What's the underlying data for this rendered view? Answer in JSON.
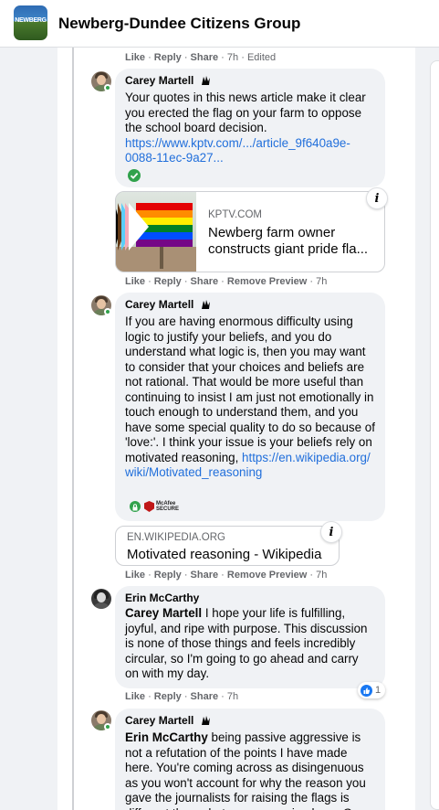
{
  "header": {
    "group_name": "Newberg-Dundee Citizens Group",
    "logo_text": "NEWBERG"
  },
  "comments": [
    {
      "actions": [
        "Like",
        "Reply",
        "Share",
        "7h",
        "Edited"
      ]
    },
    {
      "author": "Carey Martell",
      "text": "Your quotes in this news article make it clear you erected the flag on your farm to oppose the school board decision.",
      "link": "https://www.kptv.com/.../article_9f640a9e-0088-11ec-9a27...",
      "preview": {
        "source": "KPTV.COM",
        "title": "Newberg farm owner constructs giant pride fla..."
      },
      "actions": [
        "Like",
        "Reply",
        "Share",
        "Remove Preview",
        "7h"
      ]
    },
    {
      "author": "Carey Martell",
      "text": "If you are having enormous difficulty using logic to justify your beliefs, and you do understand what logic is, then you may want to consider that your choices and beliefs are not rational. That would be more useful than continuing to insist I am just not emotionally in touch enough to understand them, and you have some special quality to do so because of 'love:'. I think your issue is your beliefs rely on motivated reasoning,",
      "link": "https://en.wikipedia.org/wiki/Motivated_reasoning",
      "trust_badge": "McAfee SECURE",
      "preview": {
        "source": "EN.WIKIPEDIA.ORG",
        "title": "Motivated reasoning - Wikipedia"
      },
      "actions": [
        "Like",
        "Reply",
        "Share",
        "Remove Preview",
        "7h"
      ]
    },
    {
      "author": "Erin McCarthy",
      "mention": "Carey Martell",
      "text": " I hope your life is fulfilling, joyful, and ripe with purpose. This discussion is none of those things and feels incredibly circular, so I'm going to go ahead and carry on with my day.",
      "reaction_count": "1",
      "actions": [
        "Like",
        "Reply",
        "Share",
        "7h"
      ]
    },
    {
      "author": "Carey Martell",
      "mention": "Erin McCarthy",
      "text": " being passive aggressive is not a refutation of the points I have made here. You're coming across as disingenuous as you won't account for why the reason you gave the journalists for raising the flags is different than what you are saying here. One of them"
    }
  ],
  "colors": {
    "link": "#216fdb",
    "online": "#31a24c",
    "muted": "#65676b",
    "bubble": "#f0f2f5"
  }
}
